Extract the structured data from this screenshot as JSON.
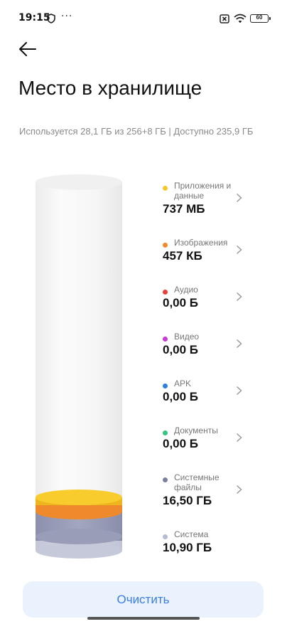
{
  "status_bar": {
    "time": "19:15",
    "dots": "···",
    "battery": "60"
  },
  "page": {
    "title": "Место в хранилище",
    "summary": "Используется 28,1 ГБ из 256+8 ГБ | Доступно 235,9 ГБ"
  },
  "categories": [
    {
      "label": "Приложения и данные",
      "size": "737 МБ",
      "color": "#f6c62c"
    },
    {
      "label": "Изображения",
      "size": "457 КБ",
      "color": "#ef8a2c"
    },
    {
      "label": "Аудио",
      "size": "0,00 Б",
      "color": "#e9403c"
    },
    {
      "label": "Видео",
      "size": "0,00 Б",
      "color": "#c93bd6"
    },
    {
      "label": "APK",
      "size": "0,00 Б",
      "color": "#2f7fe0"
    },
    {
      "label": "Документы",
      "size": "0,00 Б",
      "color": "#33c47f"
    },
    {
      "label": "Системные файлы",
      "size": "16,50 ГБ",
      "color": "#7c80a0"
    },
    {
      "label": "Система",
      "size": "10,90 ГБ",
      "color": "#b5bbd0"
    }
  ],
  "actions": {
    "clear_label": "Очистить"
  },
  "colors": {
    "accent": "#3b7de6",
    "button_bg": "#eaf2fd"
  }
}
